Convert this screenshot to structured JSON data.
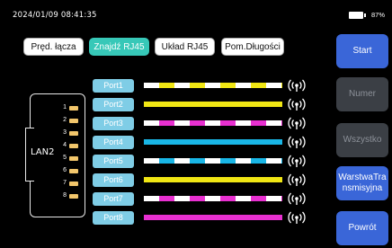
{
  "status": {
    "datetime": "2024/01/09 08:41:35",
    "battery": "87%"
  },
  "tabs": [
    {
      "label": "Pręd. łącza",
      "active": false
    },
    {
      "label": "Znajdź RJ45",
      "active": true
    },
    {
      "label": "Układ RJ45",
      "active": false
    },
    {
      "label": "Pom.Długości",
      "active": false
    }
  ],
  "side_buttons": [
    {
      "label": "Start",
      "enabled": true
    },
    {
      "label": "Numer",
      "enabled": false
    },
    {
      "label": "Wszystko",
      "enabled": false
    },
    {
      "label": "WarstwaTransmisyjna",
      "enabled": true
    },
    {
      "label": "Powrót",
      "enabled": true
    }
  ],
  "connector": {
    "label": "LAN2",
    "pins": [
      "1",
      "2",
      "3",
      "4",
      "5",
      "6",
      "7",
      "8"
    ]
  },
  "ports": [
    {
      "label": "Port1",
      "base": "#ffffff",
      "stripe": "#f0e614",
      "striped": true
    },
    {
      "label": "Port2",
      "base": "#f0e614",
      "stripe": "#f0e614",
      "striped": false
    },
    {
      "label": "Port3",
      "base": "#ffffff",
      "stripe": "#e830d0",
      "striped": true
    },
    {
      "label": "Port4",
      "base": "#19b6e6",
      "stripe": "#19b6e6",
      "striped": false
    },
    {
      "label": "Port5",
      "base": "#ffffff",
      "stripe": "#19b6e6",
      "striped": true
    },
    {
      "label": "Port6",
      "base": "#f0e614",
      "stripe": "#f0e614",
      "striped": false
    },
    {
      "label": "Port7",
      "base": "#ffffff",
      "stripe": "#e830d0",
      "striped": true
    },
    {
      "label": "Port8",
      "base": "#e830d0",
      "stripe": "#e830d0",
      "striped": false
    }
  ],
  "colors": {
    "tab_active": "#37c8b8",
    "button_blue": "#3a66d8",
    "button_disabled": "#3b3f45",
    "port_label_bg": "#7fcde6",
    "pin": "#f2c66b"
  },
  "icons": {
    "signal": "wireless-signal-icon",
    "battery": "battery-icon"
  }
}
